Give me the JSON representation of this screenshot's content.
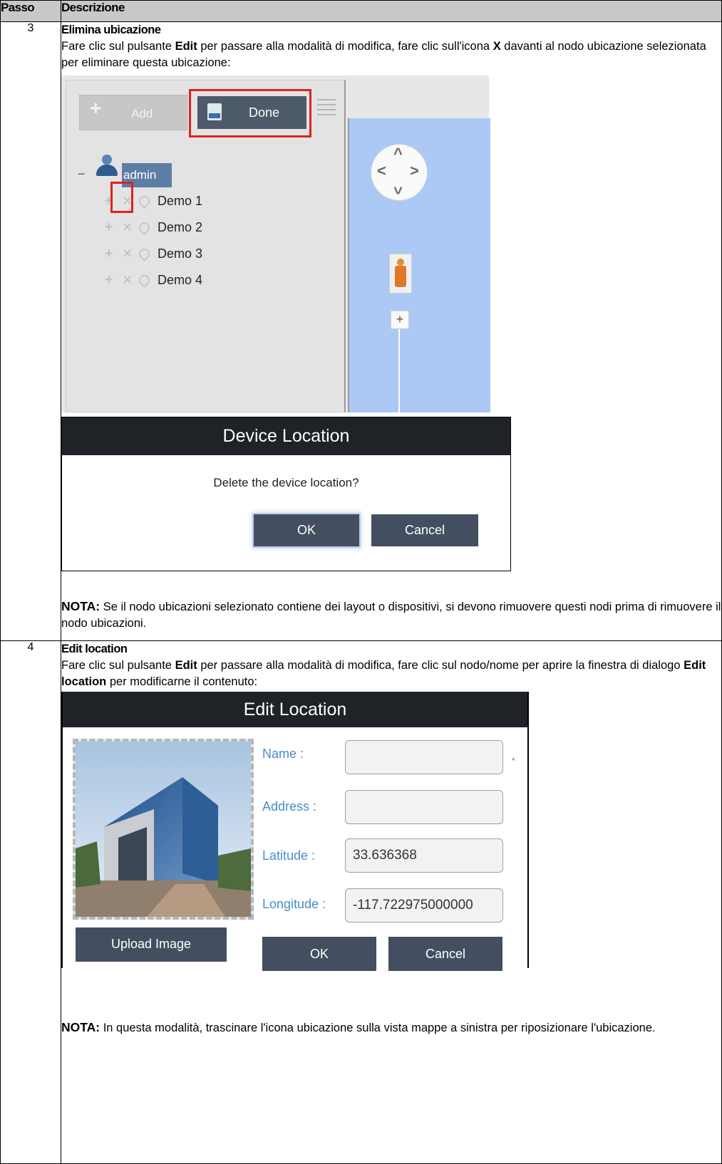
{
  "table": {
    "col_step": "Passo",
    "col_desc": "Descrizione"
  },
  "step3": {
    "number": "3",
    "title": "Elimina ubicazione",
    "instr_1": "Fare clic sul pulsante ",
    "instr_edit": "Edit",
    "instr_2": " per passare alla modalità di modifica, fare clic sull'icona ",
    "instr_x": "X",
    "instr_3": " davanti al nodo ubicazione selezionata per eliminare questa ubicazione:",
    "screenshot": {
      "add_label": "Add",
      "done_label": "Done",
      "root_user": "admin",
      "items": [
        "Demo 1",
        "Demo 2",
        "Demo 3",
        "Demo 4"
      ],
      "plus_icon": "+",
      "x_icon": "✕"
    },
    "dialog": {
      "title": "Device Location",
      "message": "Delete the device location?",
      "ok_label": "OK",
      "cancel_label": "Cancel"
    },
    "note_label": "NOTA:",
    "note_text": " Se il nodo ubicazioni selezionato contiene dei layout o dispositivi, si devono rimuovere questi nodi prima di rimuovere il nodo ubicazioni."
  },
  "step4": {
    "number": "4",
    "title": "Edit location",
    "instr_1": "Fare clic sul pulsante ",
    "instr_edit": "Edit",
    "instr_2": " per passare alla modalità di modifica, fare clic sul nodo/nome per aprire la finestra di dialogo ",
    "instr_dialog": "Edit location",
    "instr_3": " per modificarne il contenuto:",
    "dialog": {
      "title": "Edit Location",
      "name_label": "Name :",
      "name_value": "",
      "required_mark": "*",
      "address_label": "Address :",
      "address_value": "",
      "latitude_label": "Latitude :",
      "latitude_value": "33.636368",
      "longitude_label": "Longitude :",
      "longitude_value": "-117.722975000000",
      "upload_label": "Upload Image",
      "ok_label": "OK",
      "cancel_label": "Cancel"
    },
    "note_label": "NOTA:",
    "note_text": " In questa modalità, trascinare l'icona ubicazione sulla vista mappe a sinistra per riposizionare l'ubicazione."
  },
  "colors": {
    "header_bg": "#c8c8c8",
    "dialog_title_bg": "#1f2327",
    "dark_button": "#434f60",
    "highlight_red": "#e0231f",
    "map_blue": "#acc9f5",
    "field_label_blue": "#4a8cc7"
  }
}
